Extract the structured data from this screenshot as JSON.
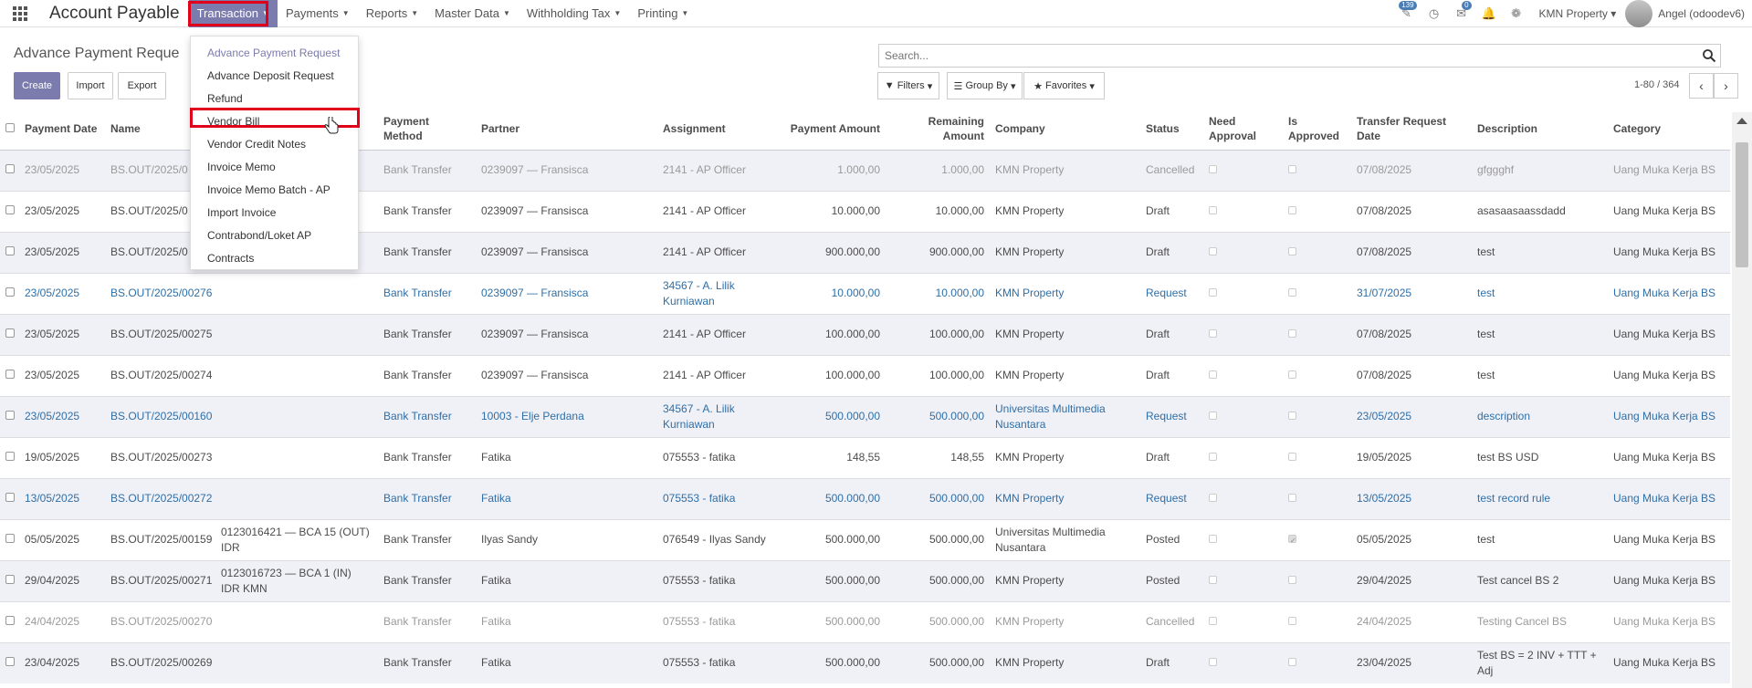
{
  "app": {
    "title": "Account Payable"
  },
  "menu": [
    {
      "label": "Transaction",
      "active": true
    },
    {
      "label": "Payments"
    },
    {
      "label": "Reports"
    },
    {
      "label": "Master Data"
    },
    {
      "label": "Withholding Tax"
    },
    {
      "label": "Printing"
    }
  ],
  "nav_right": {
    "activity_badge": "139",
    "chat_badge": "0",
    "company": "KMN Property",
    "user": "Angel (odoodev6)"
  },
  "page": {
    "title": "Advance Payment Reque",
    "create_label": "Create",
    "import_label": "Import",
    "export_label": "Export",
    "search_placeholder": "Search...",
    "filters_label": "Filters",
    "groupby_label": "Group By",
    "favorites_label": "Favorites",
    "pager": "1-80 / 364"
  },
  "dropdown": {
    "items": [
      "Advance Payment Request",
      "Advance Deposit Request",
      "Refund",
      "Vendor Bill",
      "Vendor Credit Notes",
      "Invoice Memo",
      "Invoice Memo Batch - AP",
      "Import Invoice",
      "Contrabond/Loket AP",
      "Contracts"
    ],
    "highlighted": "Vendor Bill"
  },
  "table": {
    "headers": [
      "Payment Date",
      "Name",
      "",
      "Payment Method",
      "Partner",
      "Assignment",
      "Payment Amount",
      "Remaining Amount",
      "Company",
      "Status",
      "Need Approval",
      "Is Approved",
      "Transfer Request Date",
      "Description",
      "Category"
    ],
    "rows": [
      {
        "date": "23/05/2025",
        "name": "BS.OUT/2025/0",
        "bank": "",
        "method": "Bank Transfer",
        "partner": "0239097 — Fransisca",
        "assignment": "2141 - AP Officer",
        "amount": "1.000,00",
        "remaining": "1.000,00",
        "company": "KMN Property",
        "status": "Cancelled",
        "approved": false,
        "transfer": "07/08/2025",
        "desc": "gfggghf",
        "category": "Uang Muka Kerja BS",
        "style": "muted"
      },
      {
        "date": "23/05/2025",
        "name": "BS.OUT/2025/0",
        "bank": "",
        "method": "Bank Transfer",
        "partner": "0239097 — Fransisca",
        "assignment": "2141 - AP Officer",
        "amount": "10.000,00",
        "remaining": "10.000,00",
        "company": "KMN Property",
        "status": "Draft",
        "approved": false,
        "transfer": "07/08/2025",
        "desc": "asasaasaassdadd",
        "category": "Uang Muka Kerja BS",
        "style": ""
      },
      {
        "date": "23/05/2025",
        "name": "BS.OUT/2025/0",
        "bank": "",
        "method": "Bank Transfer",
        "partner": "0239097 — Fransisca",
        "assignment": "2141 - AP Officer",
        "amount": "900.000,00",
        "remaining": "900.000,00",
        "company": "KMN Property",
        "status": "Draft",
        "approved": false,
        "transfer": "07/08/2025",
        "desc": "test",
        "category": "Uang Muka Kerja BS",
        "style": ""
      },
      {
        "date": "23/05/2025",
        "name": "BS.OUT/2025/00276",
        "bank": "",
        "method": "Bank Transfer",
        "partner": "0239097 — Fransisca",
        "assignment": "34567 - A. Lilik Kurniawan",
        "amount": "10.000,00",
        "remaining": "10.000,00",
        "company": "KMN Property",
        "status": "Request",
        "approved": false,
        "transfer": "31/07/2025",
        "desc": "test",
        "category": "Uang Muka Kerja BS",
        "style": "req"
      },
      {
        "date": "23/05/2025",
        "name": "BS.OUT/2025/00275",
        "bank": "",
        "method": "Bank Transfer",
        "partner": "0239097 — Fransisca",
        "assignment": "2141 - AP Officer",
        "amount": "100.000,00",
        "remaining": "100.000,00",
        "company": "KMN Property",
        "status": "Draft",
        "approved": false,
        "transfer": "07/08/2025",
        "desc": "test",
        "category": "Uang Muka Kerja BS",
        "style": ""
      },
      {
        "date": "23/05/2025",
        "name": "BS.OUT/2025/00274",
        "bank": "",
        "method": "Bank Transfer",
        "partner": "0239097 — Fransisca",
        "assignment": "2141 - AP Officer",
        "amount": "100.000,00",
        "remaining": "100.000,00",
        "company": "KMN Property",
        "status": "Draft",
        "approved": false,
        "transfer": "07/08/2025",
        "desc": "test",
        "category": "Uang Muka Kerja BS",
        "style": ""
      },
      {
        "date": "23/05/2025",
        "name": "BS.OUT/2025/00160",
        "bank": "",
        "method": "Bank Transfer",
        "partner": "10003 - Elje Perdana",
        "assignment": "34567 - A. Lilik Kurniawan",
        "amount": "500.000,00",
        "remaining": "500.000,00",
        "company": "Universitas Multimedia Nusantara",
        "status": "Request",
        "approved": false,
        "transfer": "23/05/2025",
        "desc": "description",
        "category": "Uang Muka Kerja BS",
        "style": "req"
      },
      {
        "date": "19/05/2025",
        "name": "BS.OUT/2025/00273",
        "bank": "",
        "method": "Bank Transfer",
        "partner": "Fatika",
        "assignment": "075553 - fatika",
        "amount": "148,55",
        "remaining": "148,55",
        "company": "KMN Property",
        "status": "Draft",
        "approved": false,
        "transfer": "19/05/2025",
        "desc": "test BS USD",
        "category": "Uang Muka Kerja BS",
        "style": ""
      },
      {
        "date": "13/05/2025",
        "name": "BS.OUT/2025/00272",
        "bank": "",
        "method": "Bank Transfer",
        "partner": "Fatika",
        "assignment": "075553 - fatika",
        "amount": "500.000,00",
        "remaining": "500.000,00",
        "company": "KMN Property",
        "status": "Request",
        "approved": false,
        "transfer": "13/05/2025",
        "desc": "test record rule",
        "category": "Uang Muka Kerja BS",
        "style": "req"
      },
      {
        "date": "05/05/2025",
        "name": "BS.OUT/2025/00159",
        "bank": "0123016421 — BCA 15 (OUT) IDR",
        "method": "Bank Transfer",
        "partner": "Ilyas Sandy",
        "assignment": "076549 - Ilyas Sandy",
        "amount": "500.000,00",
        "remaining": "500.000,00",
        "company": "Universitas Multimedia Nusantara",
        "status": "Posted",
        "approved": true,
        "transfer": "05/05/2025",
        "desc": "test",
        "category": "Uang Muka Kerja BS",
        "style": ""
      },
      {
        "date": "29/04/2025",
        "name": "BS.OUT/2025/00271",
        "bank": "0123016723 — BCA 1 (IN) IDR KMN",
        "method": "Bank Transfer",
        "partner": "Fatika",
        "assignment": "075553 - fatika",
        "amount": "500.000,00",
        "remaining": "500.000,00",
        "company": "KMN Property",
        "status": "Posted",
        "approved": false,
        "transfer": "29/04/2025",
        "desc": "Test cancel BS 2",
        "category": "Uang Muka Kerja BS",
        "style": ""
      },
      {
        "date": "24/04/2025",
        "name": "BS.OUT/2025/00270",
        "bank": "",
        "method": "Bank Transfer",
        "partner": "Fatika",
        "assignment": "075553 - fatika",
        "amount": "500.000,00",
        "remaining": "500.000,00",
        "company": "KMN Property",
        "status": "Cancelled",
        "approved": false,
        "transfer": "24/04/2025",
        "desc": "Testing Cancel BS",
        "category": "Uang Muka Kerja BS",
        "style": "muted"
      },
      {
        "date": "23/04/2025",
        "name": "BS.OUT/2025/00269",
        "bank": "",
        "method": "Bank Transfer",
        "partner": "Fatika",
        "assignment": "075553 - fatika",
        "amount": "500.000,00",
        "remaining": "500.000,00",
        "company": "KMN Property",
        "status": "Draft",
        "approved": false,
        "transfer": "23/04/2025",
        "desc": "Test BS = 2 INV + TTT + Adj",
        "category": "Uang Muka Kerja BS",
        "style": ""
      }
    ]
  },
  "colors": {
    "brand": "#7c7bad",
    "link": "#2f6fa6",
    "highlight": "#e0001a"
  }
}
